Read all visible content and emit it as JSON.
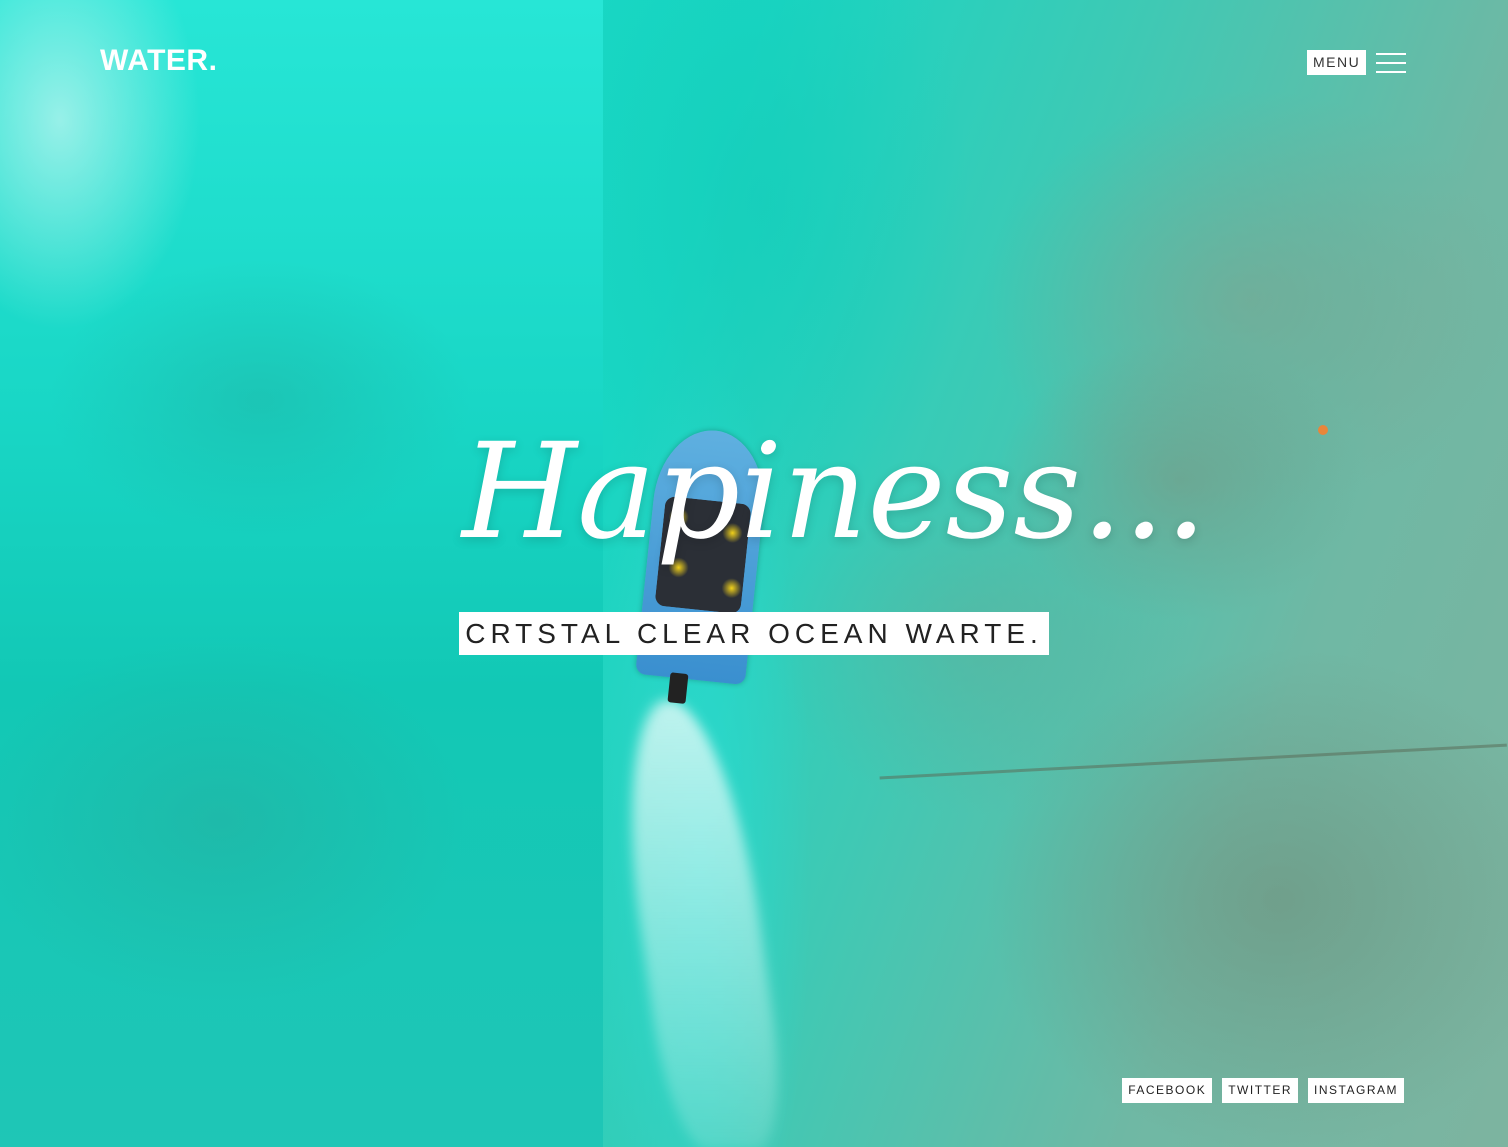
{
  "header": {
    "logo": "WATER.",
    "menu_label": "MENU"
  },
  "hero": {
    "title": "Hapiness...",
    "subtitle": "CRTSTAL CLEAR OCEAN WARTE."
  },
  "social": {
    "links": [
      {
        "label": "FACEBOOK"
      },
      {
        "label": "TWITTER"
      },
      {
        "label": "INSTAGRAM"
      }
    ]
  },
  "icons": {
    "menu": "hamburger-icon"
  }
}
